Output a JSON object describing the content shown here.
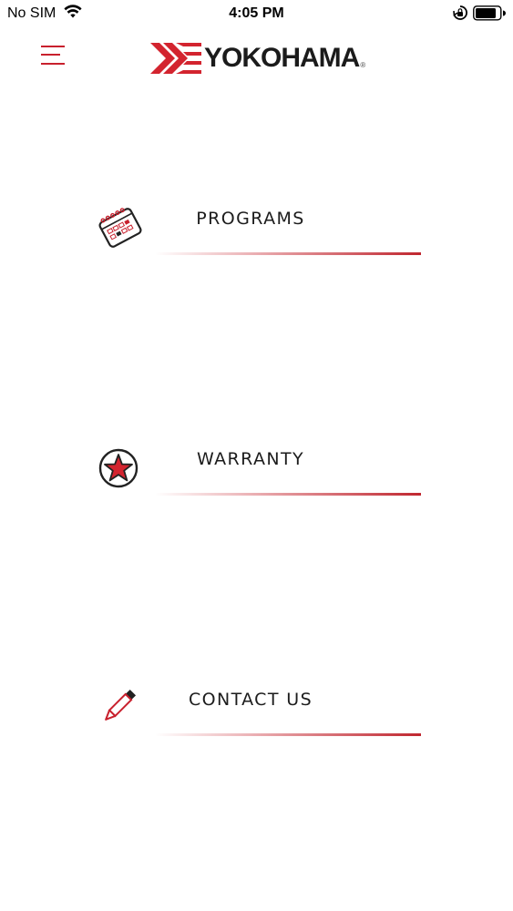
{
  "status_bar": {
    "carrier": "No SIM",
    "time": "4:05 PM",
    "wifi_icon": "wifi-icon",
    "lock_icon": "orientation-lock-icon",
    "battery_icon": "battery-icon"
  },
  "header": {
    "menu_icon": "hamburger-menu-icon",
    "brand_name": "YOKOHAMA",
    "brand_reg": "®"
  },
  "menu": {
    "items": [
      {
        "label": "PROGRAMS",
        "icon": "calendar-icon"
      },
      {
        "label": "WARRANTY",
        "icon": "star-badge-icon"
      },
      {
        "label": "CONTACT US",
        "icon": "pencil-icon"
      }
    ]
  },
  "colors": {
    "accent": "#c8202d",
    "text": "#1c1c1c",
    "background": "#ffffff"
  }
}
